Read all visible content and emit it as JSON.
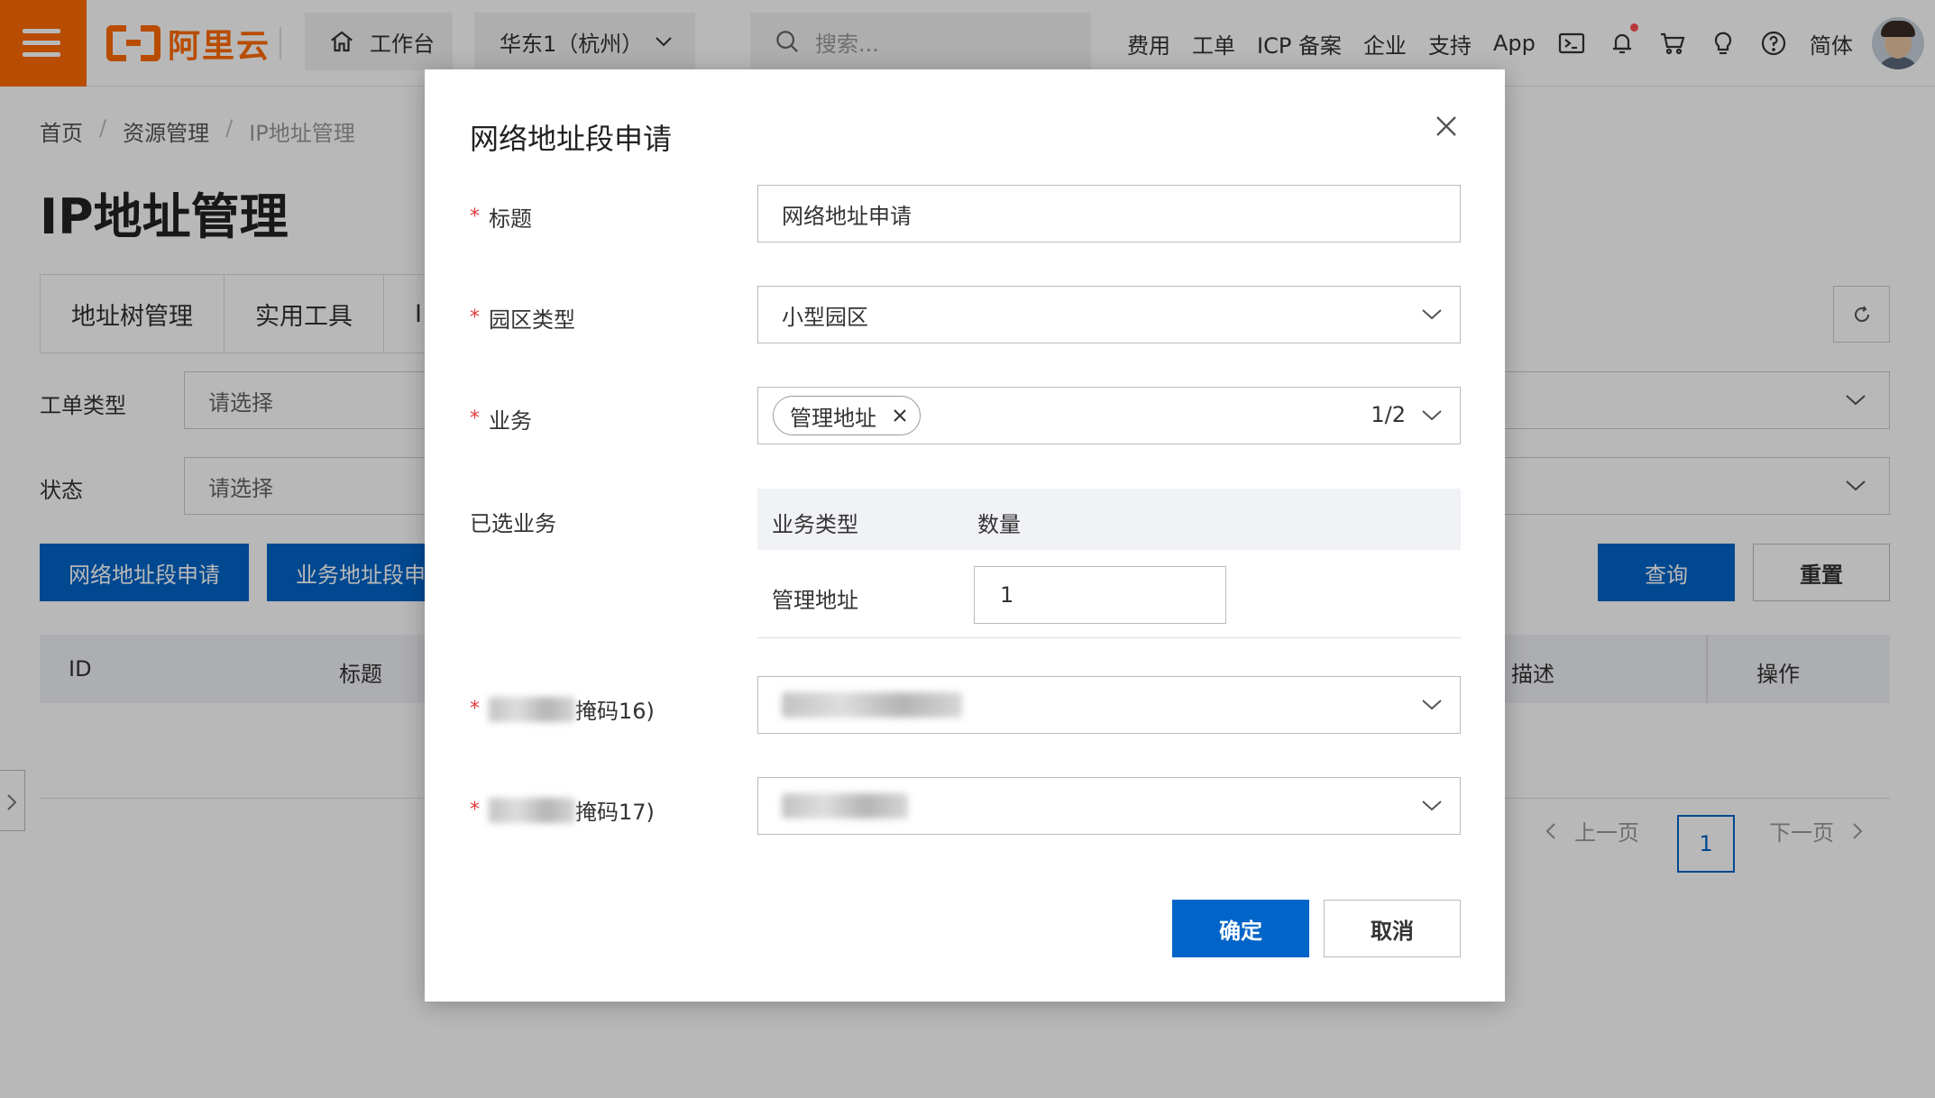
{
  "topbar": {
    "logo_text": "阿里云",
    "workbench": "工作台",
    "region": "华东1（杭州）",
    "search_placeholder": "搜索...",
    "links": [
      "费用",
      "工单",
      "ICP 备案",
      "企业",
      "支持",
      "App"
    ],
    "language": "简体",
    "accent_color": "#ff6a00"
  },
  "page": {
    "breadcrumb": [
      "首页",
      "资源管理",
      "IP地址管理"
    ],
    "title": "IP地址管理",
    "tabs": [
      "地址树管理",
      "实用工具",
      "I"
    ],
    "filters": [
      {
        "label": "工单类型",
        "placeholder": "请选择"
      },
      {
        "label": "状态",
        "placeholder": "请选择"
      }
    ],
    "buttons": {
      "network_apply": "网络地址段申请",
      "business_apply": "业务地址段申",
      "query": "查询",
      "reset": "重置"
    },
    "table_columns": {
      "id": "ID",
      "title": "标题",
      "desc": "描述",
      "ops": "操作"
    },
    "pager": {
      "prev": "上一页",
      "current": "1",
      "next": "下一页"
    }
  },
  "modal": {
    "title": "网络地址段申请",
    "fields": {
      "title_label": "标题",
      "title_value": "网络地址申请",
      "park_type_label": "园区类型",
      "park_type_value": "小型园区",
      "business_label": "业务",
      "business_tag": "管理地址",
      "business_counter": "1/2",
      "selected_label": "已选业务",
      "mask16_label_suffix": "掩码16)",
      "mask17_label_suffix": "掩码17)"
    },
    "selected_table": {
      "col_type": "业务类型",
      "col_qty": "数量",
      "row_name": "管理地址",
      "row_qty": "1"
    },
    "buttons": {
      "ok": "确定",
      "cancel": "取消"
    },
    "primary_color": "#0064c8"
  }
}
